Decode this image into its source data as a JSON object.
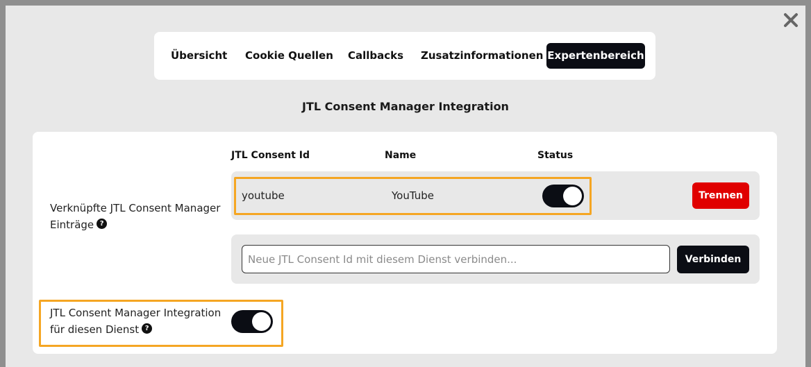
{
  "tabs": [
    {
      "label": "Übersicht"
    },
    {
      "label": "Cookie Quellen"
    },
    {
      "label": "Callbacks"
    },
    {
      "label": "Zusatzinformationen"
    },
    {
      "label": "Expertenbereich",
      "active": true
    }
  ],
  "section": {
    "title": "JTL Consent Manager Integration"
  },
  "table": {
    "headers": [
      "JTL Consent Id",
      "Name",
      "Status"
    ],
    "linked_label": "Verknüpfte JTL Consent Manager Einträge",
    "rows": [
      {
        "consent_id": "youtube",
        "name": "YouTube",
        "status_on": true,
        "action_label": "Trennen"
      }
    ]
  },
  "new_link": {
    "placeholder": "Neue JTL Consent Id mit diesem Dienst verbinden...",
    "value": "",
    "button_label": "Verbinden"
  },
  "integration": {
    "label": "JTL Consent Manager Integration für diesen Dienst",
    "enabled": true
  },
  "icons": {
    "close": "close-icon",
    "help": "help-icon"
  },
  "colors": {
    "accent_dark": "#0b0d14",
    "danger": "#e00000",
    "highlight": "#f5a623"
  },
  "help_glyph": "?"
}
